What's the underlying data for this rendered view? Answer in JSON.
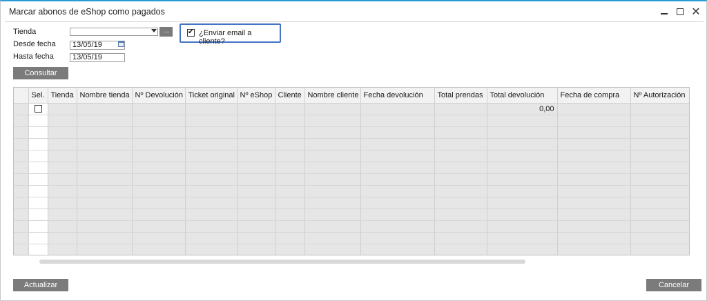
{
  "window": {
    "title": "Marcar abonos de eShop como pagados",
    "controls": {
      "minimize": "minimize-icon",
      "maximize": "maximize-icon",
      "close": "✕"
    }
  },
  "form": {
    "tienda_label": "Tienda",
    "tienda_value": "",
    "browse_label": "...",
    "desde_label": "Desde fecha",
    "desde_value": "13/05/19",
    "hasta_label": "Hasta fecha",
    "hasta_value": "13/05/19",
    "email_label": "¿Enviar email a cliente?",
    "email_checked": true,
    "consultar_label": "Consultar"
  },
  "grid": {
    "columns": [
      "Sel.",
      "Tienda",
      "Nombre tienda",
      "Nº Devolución",
      "Ticket original",
      "Nº eShop",
      "Cliente",
      "Nombre cliente",
      "Fecha devolución",
      "Total prendas",
      "Total devolución",
      "Fecha de compra",
      "Nº Autorización"
    ],
    "first_row": {
      "total_devolucion": "0,00"
    },
    "empty_rows": 12
  },
  "footer": {
    "actualizar_label": "Actualizar",
    "cancelar_label": "Cancelar"
  },
  "colors": {
    "accent_border": "#4472c4",
    "button_bg": "#7b7b7b",
    "title_accent": "#2b9bd6"
  }
}
